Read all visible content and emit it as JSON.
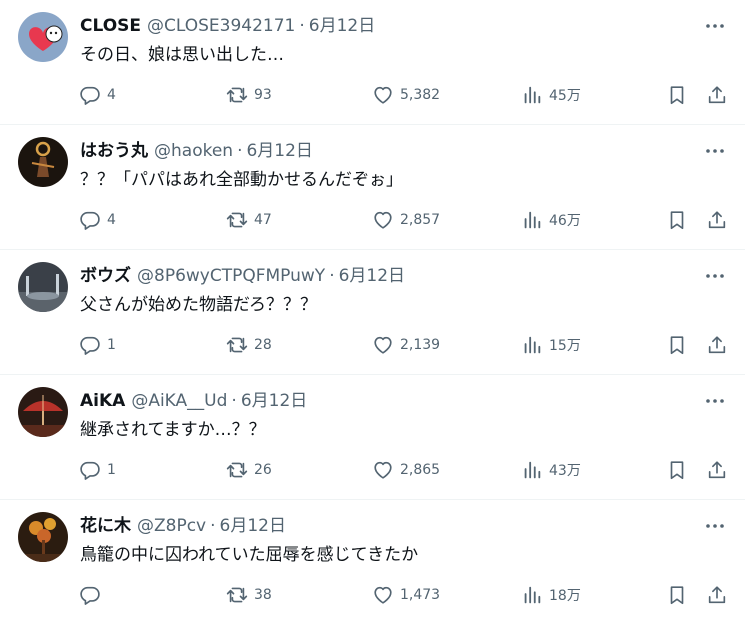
{
  "tweets": [
    {
      "name": "CLOSE",
      "handle": "@CLOSE3942171",
      "date": "6月12日",
      "text": "その日、娘は思い出した…",
      "replies": "4",
      "retweets": "93",
      "likes": "5,382",
      "views": "45万",
      "avatar": "heart-bear-avatar"
    },
    {
      "name": "はおう丸",
      "handle": "@haoken",
      "date": "6月12日",
      "text": "？？「パパはあれ全部動かせるんだぞぉ」",
      "replies": "4",
      "retweets": "47",
      "likes": "2,857",
      "views": "46万",
      "avatar": "dark-figure-avatar"
    },
    {
      "name": "ボウズ",
      "handle": "@8P6wyCTPQFMPuwY",
      "date": "6月12日",
      "text": "父さんが始めた物語だろ？？？",
      "replies": "1",
      "retweets": "28",
      "likes": "2,139",
      "views": "15万",
      "avatar": "stadium-avatar"
    },
    {
      "name": "AiKA",
      "handle": "@AiKA__Ud",
      "date": "6月12日",
      "text": "継承されてますか…？？",
      "replies": "1",
      "retweets": "26",
      "likes": "2,865",
      "views": "43万",
      "avatar": "red-umbrella-avatar"
    },
    {
      "name": "花に木",
      "handle": "@Z8Pcv",
      "date": "6月12日",
      "text": "鳥籠の中に囚われていた屈辱を感じてきたか",
      "replies": "",
      "retweets": "38",
      "likes": "1,473",
      "views": "18万",
      "avatar": "flower-tree-avatar"
    }
  ],
  "separator": "·",
  "colors": {
    "text": "#0f1419",
    "muted": "#536471",
    "divider": "#eff3f4"
  }
}
